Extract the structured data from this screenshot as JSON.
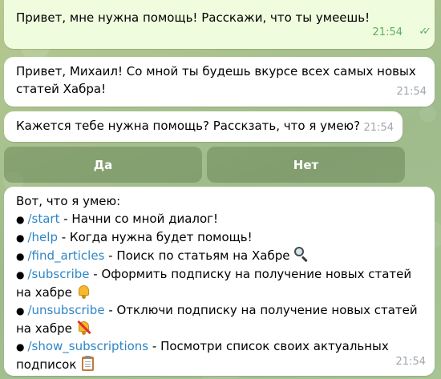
{
  "messages": {
    "user_msg": {
      "text": "Привет, мне нужна помощь! Расскажи, что ты умеешь!",
      "time": "21:54",
      "status": "✓✓"
    },
    "bot_greeting": {
      "line1": "Привет, Михаил! Со мной ты будешь вкурсе всех самых новых",
      "line2": "статей Хабра!",
      "time": "21:54"
    },
    "bot_question": {
      "text": "Кажется тебе нужна помощь? Расскзать, что я умею?",
      "time": "21:54"
    },
    "bot_help": {
      "intro": "Вот, что я умею:",
      "bullet": "●",
      "items": [
        {
          "cmd": "/start",
          "desc": " - Начни со мной диалог!"
        },
        {
          "cmd": "/help",
          "desc": " - Когда нужна будет помощь!"
        },
        {
          "cmd": "/find_articles",
          "desc": " - Поиск по статьям на Хабре ",
          "icon": "magnifier-icon"
        },
        {
          "cmd": "/subscribe",
          "desc": " - Оформить подписку на получение новых статей",
          "desc2": "на хабре ",
          "icon": "bell-icon"
        },
        {
          "cmd": "/unsubscribe",
          "desc": " - Отключи подписку на получение новых статей",
          "desc2": "на хабре ",
          "icon": "bell-slash-icon"
        },
        {
          "cmd": "/show_subscriptions",
          "desc": " - Посмотри список своих актуальных",
          "desc2": "подписок ",
          "icon": "clipboard-icon"
        }
      ],
      "time": "21:54"
    }
  },
  "keyboard": {
    "yes_label": "Да",
    "no_label": "Нет"
  },
  "colors": {
    "outgoing_bubble": "#effdde",
    "incoming_bubble": "#ffffff",
    "link": "#2f85c6",
    "keyboard_button": "#5a7848"
  }
}
